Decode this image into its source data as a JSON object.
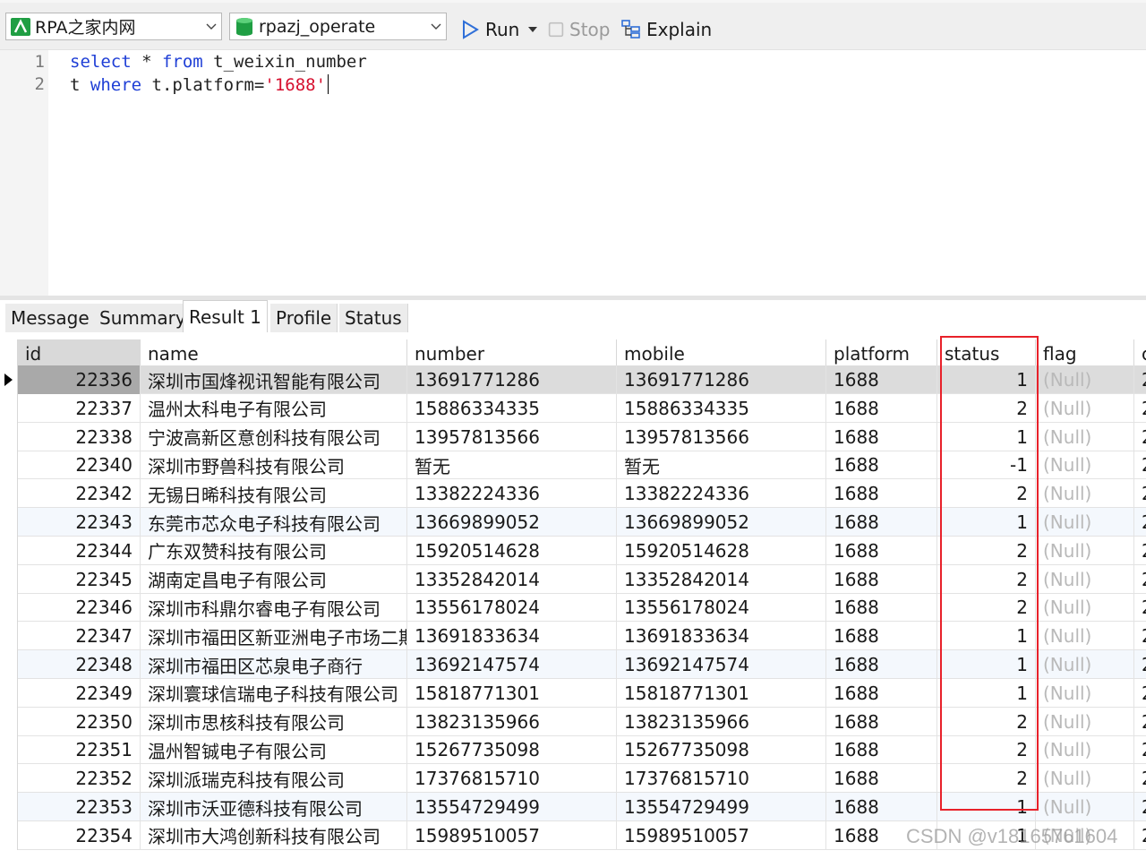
{
  "toolbar": {
    "connection": "RPA之家内网",
    "database": "rpazj_operate",
    "run_label": "Run",
    "stop_label": "Stop",
    "explain_label": "Explain"
  },
  "editor": {
    "line_numbers": [
      "1",
      "2"
    ],
    "line1": {
      "kw1": "select",
      "mid": " * ",
      "kw2": "from",
      "rest": " t_weixin_number"
    },
    "line2": {
      "pre": "t ",
      "kw": "where",
      "mid": " t.platform=",
      "str": "'1688'"
    }
  },
  "tabs": [
    "Message",
    "Summary",
    "Result 1",
    "Profile",
    "Status"
  ],
  "active_tab": "Result 1",
  "grid": {
    "columns": [
      "id",
      "name",
      "number",
      "mobile",
      "platform",
      "status",
      "flag",
      "c"
    ],
    "rows": [
      [
        "22336",
        "深圳市国烽视讯智能有限公司",
        "13691771286",
        "13691771286",
        "1688",
        "1",
        "(Null)",
        "2"
      ],
      [
        "22337",
        "温州太科电子有限公司",
        "15886334335",
        "15886334335",
        "1688",
        "2",
        "(Null)",
        "2"
      ],
      [
        "22338",
        "宁波高新区意创科技有限公司",
        "13957813566",
        "13957813566",
        "1688",
        "1",
        "(Null)",
        "2"
      ],
      [
        "22340",
        "深圳市野兽科技有限公司",
        "暂无",
        "暂无",
        "1688",
        "-1",
        "(Null)",
        "2"
      ],
      [
        "22342",
        "无锡日晞科技有限公司",
        "13382224336",
        "13382224336",
        "1688",
        "2",
        "(Null)",
        "2"
      ],
      [
        "22343",
        "东莞市芯众电子科技有限公司",
        "13669899052",
        "13669899052",
        "1688",
        "1",
        "(Null)",
        "2"
      ],
      [
        "22344",
        "广东双赞科技有限公司",
        "15920514628",
        "15920514628",
        "1688",
        "2",
        "(Null)",
        "2"
      ],
      [
        "22345",
        "湖南定昌电子有限公司",
        "13352842014",
        "13352842014",
        "1688",
        "2",
        "(Null)",
        "2"
      ],
      [
        "22346",
        "深圳市科鼎尔睿电子有限公司",
        "13556178024",
        "13556178024",
        "1688",
        "2",
        "(Null)",
        "2"
      ],
      [
        "22347",
        "深圳市福田区新亚洲电子市场二期",
        "13691833634",
        "13691833634",
        "1688",
        "1",
        "(Null)",
        "2"
      ],
      [
        "22348",
        "深圳市福田区芯泉电子商行",
        "13692147574",
        "13692147574",
        "1688",
        "1",
        "(Null)",
        "2"
      ],
      [
        "22349",
        "深圳寰球信瑞电子科技有限公司",
        "15818771301",
        "15818771301",
        "1688",
        "1",
        "(Null)",
        "2"
      ],
      [
        "22350",
        "深圳市思核科技有限公司",
        "13823135966",
        "13823135966",
        "1688",
        "2",
        "(Null)",
        "2"
      ],
      [
        "22351",
        "温州智铖电子有限公司",
        "15267735098",
        "15267735098",
        "1688",
        "2",
        "(Null)",
        "2"
      ],
      [
        "22352",
        "深圳派瑞克科技有限公司",
        "17376815710",
        "17376815710",
        "1688",
        "2",
        "(Null)",
        "2"
      ],
      [
        "22353",
        "深圳市沃亚德科技有限公司",
        "13554729499",
        "13554729499",
        "1688",
        "1",
        "(Null)",
        "2"
      ],
      [
        "22354",
        "深圳市大鸿创新科技有限公司",
        "15989510057",
        "15989510057",
        "1688",
        "1",
        "(Null)",
        "2"
      ]
    ]
  },
  "watermark": "CSDN @v18165761604",
  "colors": {
    "highlight_box": "#e8212a",
    "keyword": "#1f3fd6",
    "string": "#d60f2e",
    "null": "#b9b9b9"
  }
}
